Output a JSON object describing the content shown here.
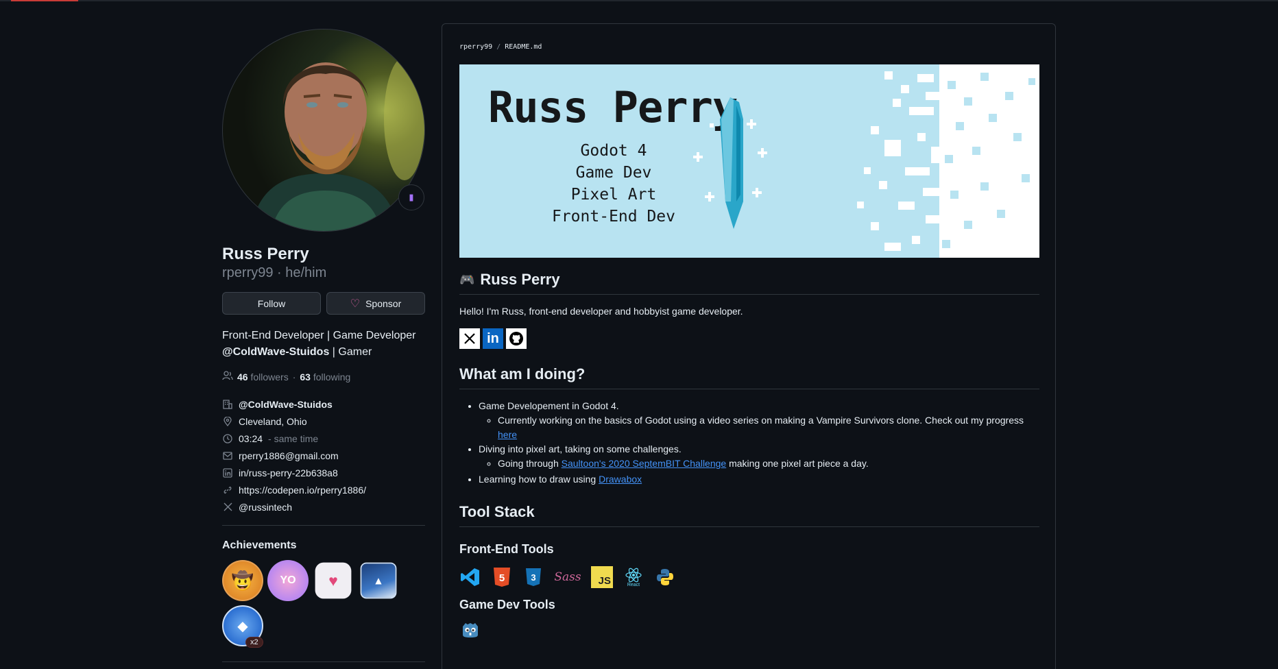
{
  "profile": {
    "name": "Russ Perry",
    "login_line": "rperry99 · he/him",
    "follow_label": "Follow",
    "sponsor_label": "Sponsor",
    "bio_line1": "Front-End Developer | Game Developer",
    "bio_org": "@ColdWave-Stuidos",
    "bio_rest": " | Gamer",
    "followers_count": "46",
    "followers_label": "followers",
    "following_count": "63",
    "following_label": "following",
    "details": {
      "org": "@ColdWave-Stuidos",
      "location": "Cleveland, Ohio",
      "time": "03:24",
      "time_suffix": "- same time",
      "email": "rperry1886@gmail.com",
      "linkedin": "in/russ-perry-22b638a8",
      "website": "https://codepen.io/rperry1886/",
      "twitter": "@russintech"
    },
    "achievements_title": "Achievements",
    "badge_count": "x2"
  },
  "readme": {
    "crumb_user": "rperry99",
    "crumb_sep": "/",
    "crumb_file": "README.md",
    "banner": {
      "title": "Russ Perry",
      "lines": [
        "Godot 4",
        "Game Dev",
        "Pixel Art",
        "Front-End Dev"
      ]
    },
    "heading1": "Russ Perry",
    "intro": "Hello! I'm Russ, front-end developer and hobbyist game developer.",
    "heading2": "What am I doing?",
    "items": {
      "godot": "Game Developement in Godot 4.",
      "godot_sub": "Currently working on the basics of Godot using a video series on making a Vampire Survivors clone. Check out my progress ",
      "godot_sub_link": "here",
      "pixel": "Diving into pixel art, taking on some challenges.",
      "pixel_sub_pre": "Going through ",
      "pixel_sub_link": "Saultoon's 2020 SeptemBIT Challenge",
      "pixel_sub_post": " making one pixel art piece a day.",
      "draw_pre": "Learning how to draw using ",
      "draw_link": "Drawabox"
    },
    "heading3": "Tool Stack",
    "frontend_title": "Front-End Tools",
    "gamedev_title": "Game Dev Tools",
    "tool_labels": {
      "html": "5",
      "css": "3",
      "sass": "Sass",
      "js": "JS",
      "react": "React"
    }
  }
}
